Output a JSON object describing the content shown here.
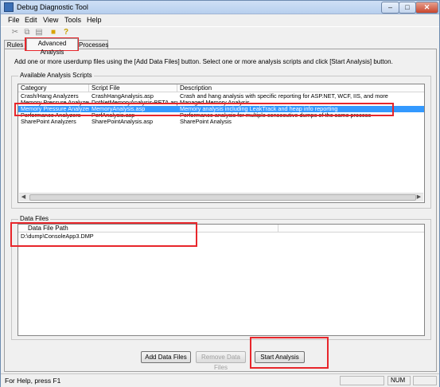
{
  "window": {
    "title": "Debug Diagnostic Tool"
  },
  "menu": {
    "file": "File",
    "edit": "Edit",
    "view": "View",
    "tools": "Tools",
    "help": "Help"
  },
  "toolbar": {
    "cut_icon": "scissors-icon",
    "copy_icon": "copy-icon",
    "paste_icon": "paste-icon",
    "open_icon": "folder-icon",
    "help_icon": "help-icon"
  },
  "tabs": {
    "rules": "Rules",
    "advanced": "Advanced Analysis",
    "processes": "Processes"
  },
  "instructions": "Add one or more userdump files using the [Add Data Files] button. Select one or more analysis scripts and click [Start Analysis] button.",
  "scripts": {
    "group_label": "Available Analysis Scripts",
    "columns": {
      "category": "Category",
      "script_file": "Script File",
      "description": "Description"
    },
    "rows": [
      {
        "category": "Crash/Hang Analyzers",
        "script": "CrashHangAnalysis.asp",
        "description": "Crash and hang analysis with specific reporting for ASP.NET, WCF, IIS, and more"
      },
      {
        "category": "Memory Pressure Analyzers",
        "script": "DotNetMemoryAnalysis-BETA.asp",
        "description": "Managed Memory Analysis"
      },
      {
        "category": "Memory Pressure Analyzers",
        "script": "MemoryAnalysis.asp",
        "description": "Memory analysis including LeakTrack and heap info reporting"
      },
      {
        "category": "Performance Analyzers",
        "script": "PerfAnalysis.asp",
        "description": "Performance analysis for multiple consecutive dumps of the same process"
      },
      {
        "category": "SharePoint Analyzers",
        "script": "SharePointAnalysis.asp",
        "description": "SharePoint Analysis"
      }
    ]
  },
  "data_files": {
    "group_label": "Data Files",
    "column": "Data File Path",
    "rows": [
      {
        "path": "D:\\dump\\ConsoleApp3.DMP"
      }
    ]
  },
  "buttons": {
    "add": "Add Data Files",
    "remove": "Remove Data Files",
    "start": "Start Analysis"
  },
  "status": {
    "text": "For Help, press F1",
    "num": "NUM"
  },
  "colors": {
    "selection": "#3399ff",
    "annotation": "#e8262b"
  }
}
